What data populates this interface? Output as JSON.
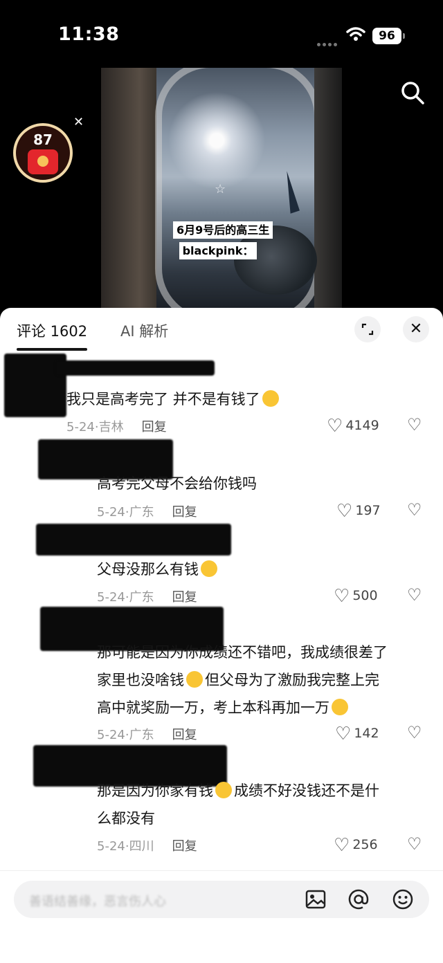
{
  "status_bar": {
    "time": "11:38",
    "battery": "96"
  },
  "video": {
    "caption_line1": "6月9号后的高三生",
    "caption_line2": "blackpink："
  },
  "red_packet": {
    "count": "87"
  },
  "comments_sheet": {
    "tab_comments": "评论 1602",
    "tab_ai": "AI 解析",
    "comments": [
      {
        "text": "我只是高考完了 并不是有钱了",
        "date": "5-24·吉林",
        "reply": "回复",
        "likes": "4149"
      },
      {
        "text": "高考完父母不会给你钱吗",
        "date": "5-24·广东",
        "reply": "回复",
        "likes": "197"
      },
      {
        "text": "父母没那么有钱",
        "date": "5-24·广东",
        "reply": "回复",
        "likes": "500"
      },
      {
        "line1": "那可能是因为你成绩还不错吧，我成绩很差了",
        "line2a": "家里也没啥钱",
        "line2b": "但父母为了激励我完整上完",
        "line3": "高中就奖励一万，考上本科再加一万",
        "date": "5-24·广东",
        "reply": "回复",
        "likes": "142"
      },
      {
        "line1a": "那是因为你家有钱",
        "line1b": "成绩不好没钱还不是什",
        "line2": "么都没有",
        "date": "5-24·四川",
        "reply": "回复",
        "likes": "256"
      }
    ]
  },
  "input_bar": {
    "placeholder": "善语结善缘，恶言伤人心"
  }
}
